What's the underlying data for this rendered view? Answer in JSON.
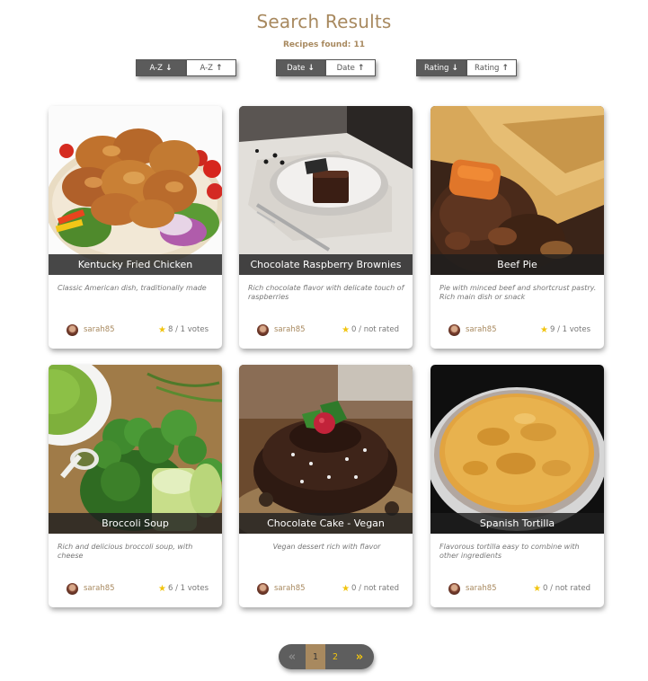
{
  "header": {
    "title": "Search Results",
    "recipes_found": "Recipes found: 11"
  },
  "sort": {
    "az_desc": "A-Z",
    "az_asc": "A-Z",
    "date_desc": "Date",
    "date_asc": "Date",
    "rating_desc": "Rating",
    "rating_asc": "Rating",
    "down_arrow": "🡓",
    "up_arrow": "🡑"
  },
  "recipes": [
    {
      "title": "Kentucky Fried Chicken",
      "description": "Classic American dish, traditionally made",
      "author": "sarah85",
      "rating": "8 / 1 votes",
      "image": "fried-chicken"
    },
    {
      "title": "Chocolate Raspberry Brownies",
      "description": "Rich chocolate flavor with delicate touch of raspberries",
      "author": "sarah85",
      "rating": "0 / not rated",
      "image": "brownies"
    },
    {
      "title": "Beef Pie",
      "description": "Pie with minced beef and shortcrust pastry. Rich main dish or snack",
      "author": "sarah85",
      "rating": "9 / 1 votes",
      "image": "beef-pie"
    },
    {
      "title": "Broccoli Soup",
      "description": "Rich and delicious broccoli soup, with cheese",
      "author": "sarah85",
      "rating": "6 / 1 votes",
      "image": "broccoli-soup"
    },
    {
      "title": "Chocolate Cake - Vegan",
      "description": "Vegan dessert rich with flavor",
      "author": "sarah85",
      "rating": "0 / not rated",
      "image": "chocolate-cake"
    },
    {
      "title": "Spanish Tortilla",
      "description": "Flavorous tortilla easy to combine with other ingredients",
      "author": "sarah85",
      "rating": "0 / not rated",
      "image": "spanish-tortilla"
    }
  ],
  "pagination": {
    "prev": "«",
    "pages": [
      "1",
      "2"
    ],
    "next": "»",
    "current": "1"
  },
  "colors": {
    "accent": "#a8895f",
    "star": "#f1c40f",
    "dark": "#5b5b5b"
  }
}
